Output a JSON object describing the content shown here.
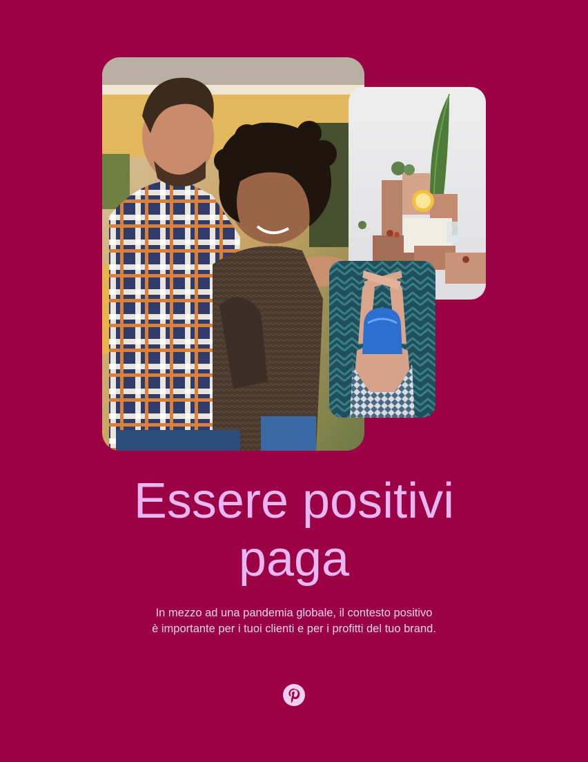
{
  "page": {
    "background_color": "#9c0045",
    "accent_text_color": "#e8b6f0"
  },
  "images": [
    {
      "name": "couple-hugging-photo"
    },
    {
      "name": "still-life-products-photo"
    },
    {
      "name": "blue-hair-woman-photo"
    }
  ],
  "headline": {
    "line1": "Essere positivi",
    "line2": "paga"
  },
  "subtitle": {
    "line1": "In mezzo ad una pandemia globale, il contesto positivo",
    "line2": "è importante per i tuoi clienti e per i profitti del tuo brand."
  },
  "logo": {
    "icon": "pinterest-logo-icon"
  }
}
